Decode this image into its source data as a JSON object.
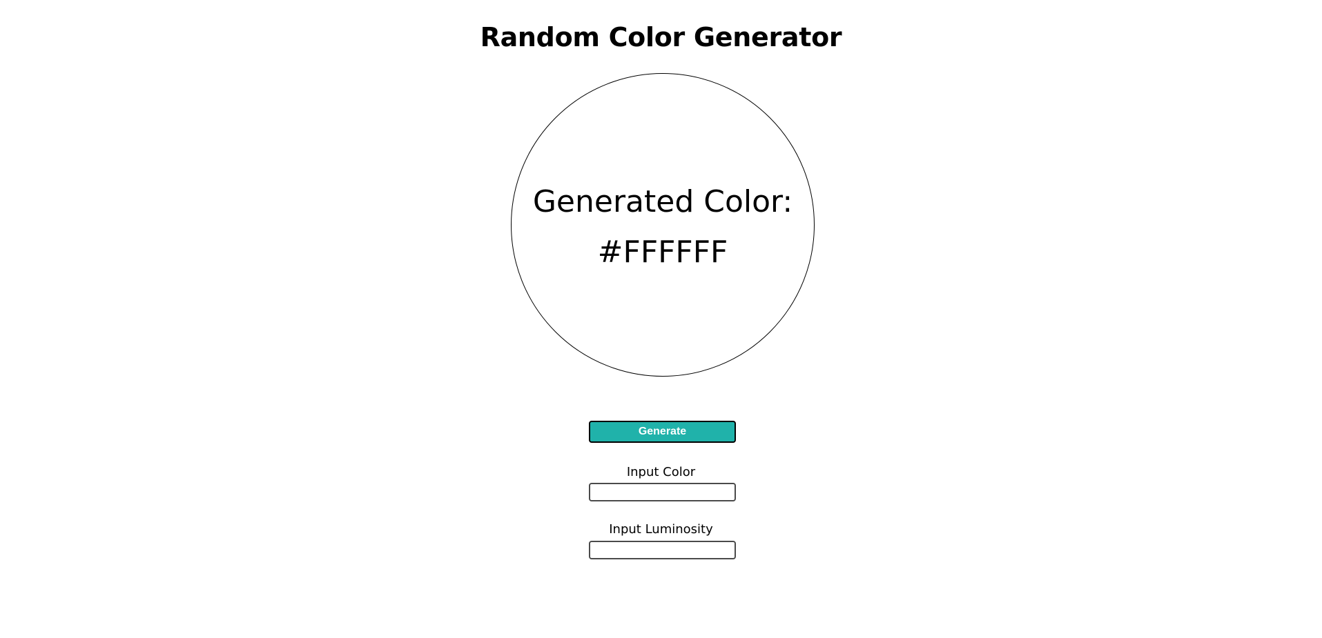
{
  "header": {
    "title": "Random Color Generator"
  },
  "color_display": {
    "line1": "Generated Color:",
    "line2": "#FFFFFF",
    "current_color": "#FFFFFF",
    "border_color": "#000000"
  },
  "controls": {
    "generate_label": "Generate",
    "generate_color": "#20B2AA",
    "input_color": {
      "label": "Input Color",
      "value": "",
      "placeholder": ""
    },
    "input_luminosity": {
      "label": "Input Luminosity",
      "value": "",
      "placeholder": ""
    }
  }
}
